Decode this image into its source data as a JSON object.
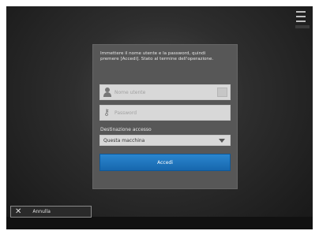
{
  "dialog": {
    "prompt": "Immettere il nome utente e la password, quindi premere [Accedi]. Stato al termine dell'operazione.",
    "username": {
      "placeholder": "Nome utente",
      "icon": "user-icon"
    },
    "password": {
      "placeholder": "Password",
      "icon": "key-icon"
    },
    "destination": {
      "label": "Destinazione accesso",
      "selected": "Questa macchina"
    },
    "login_label": "Accedi"
  },
  "footer": {
    "cancel_label": "Annulla",
    "cancel_icon": "close-icon"
  },
  "colors": {
    "accent": "#1f78c1",
    "panel": "#575757",
    "background": "#1e1e1e"
  }
}
